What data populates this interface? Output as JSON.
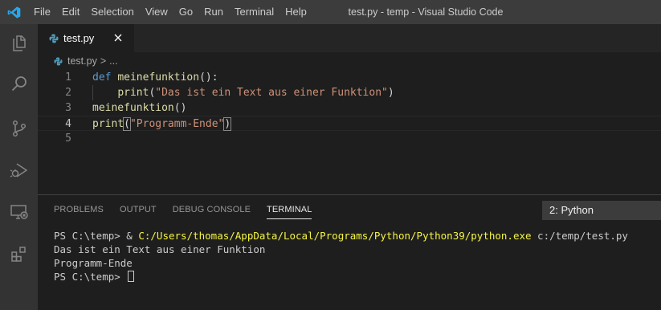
{
  "titlebar": {
    "menu": [
      "File",
      "Edit",
      "Selection",
      "View",
      "Go",
      "Run",
      "Terminal",
      "Help"
    ],
    "window_title": "test.py - temp - Visual Studio Code"
  },
  "activitybar": {
    "icons": [
      "explorer-icon",
      "search-icon",
      "source-control-icon",
      "run-debug-icon",
      "remote-explorer-icon",
      "extensions-icon"
    ]
  },
  "tabs": [
    {
      "label": "test.py",
      "icon": "python-icon",
      "active": true
    }
  ],
  "breadcrumb": {
    "file": "test.py",
    "separator": ">",
    "more": "..."
  },
  "editor": {
    "lines": [
      {
        "number": "1",
        "tokens": [
          [
            "kw",
            "def"
          ],
          [
            "pn",
            " "
          ],
          [
            "fn",
            "meinefunktion"
          ],
          [
            "pn",
            "():"
          ]
        ]
      },
      {
        "number": "2",
        "tokens": [
          [
            "pn",
            "    "
          ],
          [
            "fn",
            "print"
          ],
          [
            "pn",
            "("
          ],
          [
            "str",
            "\"Das ist ein Text aus einer Funktion\""
          ],
          [
            "pn",
            ")"
          ]
        ]
      },
      {
        "number": "3",
        "tokens": [
          [
            "fn",
            "meinefunktion"
          ],
          [
            "pn",
            "()"
          ]
        ]
      },
      {
        "number": "4",
        "tokens": [
          [
            "fn",
            "print"
          ],
          [
            "pn",
            "("
          ],
          [
            "str",
            "\"Programm-Ende\""
          ],
          [
            "pn",
            ")"
          ]
        ]
      },
      {
        "number": "5",
        "tokens": []
      }
    ],
    "active_line": 4
  },
  "panel": {
    "tabs": [
      "PROBLEMS",
      "OUTPUT",
      "DEBUG CONSOLE",
      "TERMINAL"
    ],
    "active_tab": "TERMINAL",
    "terminal_select": "2: Python",
    "terminal": {
      "line1_prompt": "PS C:\\temp> & ",
      "line1_path": "C:/Users/thomas/AppData/Local/Programs/Python/Python39/python.exe",
      "line1_arg": " c:/temp/test.py",
      "line2": "Das ist ein Text aus einer Funktion",
      "line3": "Programm-Ende",
      "line4_prompt": "PS C:\\temp> "
    }
  },
  "colors": {
    "keyword": "#569cd6",
    "function": "#dcdcaa",
    "string": "#ce9178",
    "accent": "#007acc"
  }
}
